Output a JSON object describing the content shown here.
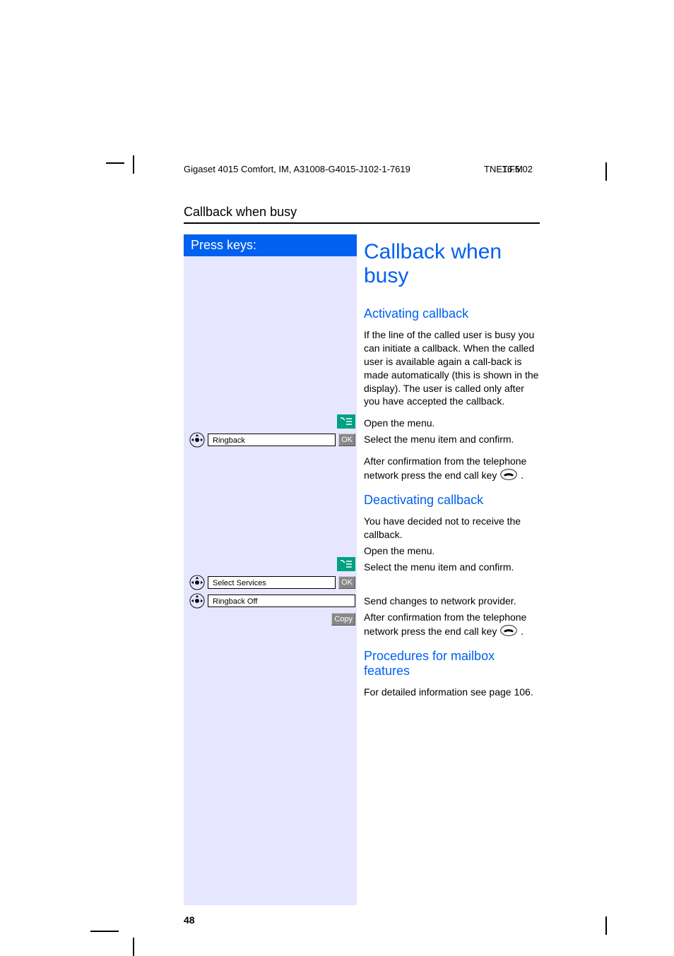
{
  "header": {
    "doc_id": "Gigaset 4015 Comfort, IM, A31008-G4015-J102-1-7619",
    "file": "TNET.FM",
    "date": "16.5.02"
  },
  "section_header": "Callback when busy",
  "press_keys_title": "Press keys:",
  "page_title": "Callback when busy",
  "activating": {
    "heading": "Activating callback",
    "intro": "If the line of the called user is busy you can initiate a callback. When the called user is available again a call-back is made automatically (this is shown in the display). The user is called only after you have accepted the callback.",
    "open_menu": "Open the menu.",
    "select_confirm": "Select the menu item and confirm.",
    "after_confirm_prefix": "After confirmation from the telephone network press the end call key ",
    "after_confirm_suffix": ".",
    "menu_item": "Ringback",
    "ok": "OK"
  },
  "deactivating": {
    "heading": "Deactivating callback",
    "intro": "You have decided not to receive the callback.",
    "open_menu": "Open the menu.",
    "select_confirm": "Select the menu item and confirm.",
    "select_services": "Select Services",
    "ringback_off": "Ringback Off",
    "send_changes": "Send changes to network provider.",
    "after_confirm_prefix": "After confirmation from the telephone network press the end call key ",
    "after_confirm_suffix": ".",
    "ok": "OK",
    "copy": "Copy"
  },
  "mailbox": {
    "heading": "Procedures for mailbox features",
    "text": "For detailed information see page 106."
  },
  "page_number": "48"
}
